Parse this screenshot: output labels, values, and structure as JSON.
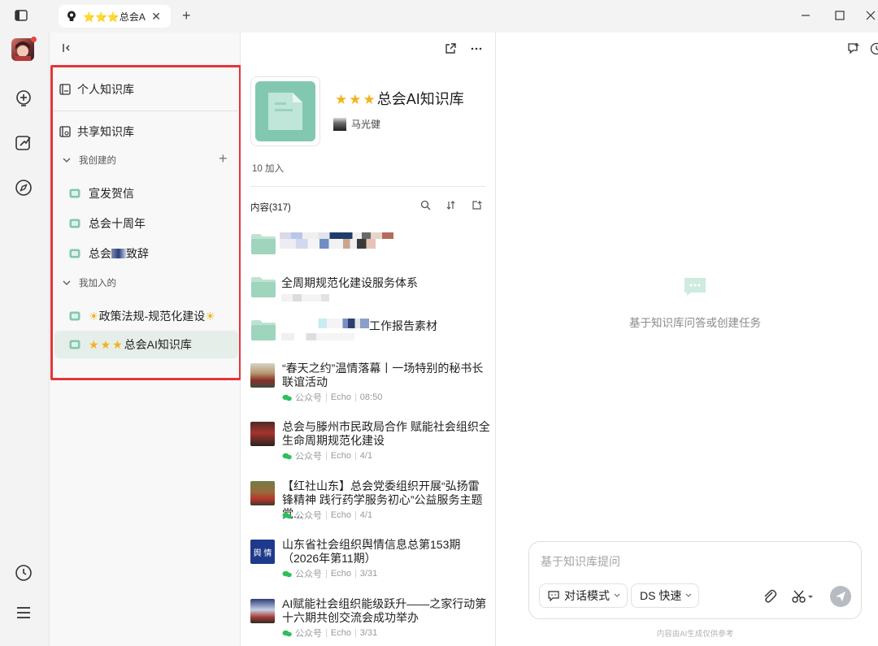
{
  "window": {
    "tab": {
      "title": "⭐⭐⭐总会AI知识库"
    }
  },
  "sidebar": {
    "personal_kb": "个人知识库",
    "shared_kb": "共享知识库",
    "created_section": "我创建的",
    "created_items": [
      {
        "label": "宣发贺信"
      },
      {
        "label": "总会十周年"
      },
      {
        "label_prefix": "总会",
        "label_suffix": "致辞"
      }
    ],
    "joined_section": "我加入的",
    "joined_items": [
      {
        "label": "政策法规-规范化建设"
      },
      {
        "label": "总会AI知识库"
      }
    ]
  },
  "detail": {
    "title": "总会AI知识库",
    "owner": "马光健",
    "join_count": "10 加入",
    "content_header": "内容(317)",
    "folders": [
      {
        "title": ""
      },
      {
        "title": "全周期规范化建设服务体系"
      },
      {
        "title": "工作报告素材"
      }
    ],
    "articles": [
      {
        "title": "“春天之约”温情落幕丨一场特别的秘书长联谊活动",
        "source": "公众号",
        "author": "Echo",
        "date": "08:50"
      },
      {
        "title": "总会与滕州市民政局合作  赋能社会组织全生命周期规范化建设",
        "source": "公众号",
        "author": "Echo",
        "date": "4/1"
      },
      {
        "title": "【红社山东】总会党委组织开展“弘扬雷锋精神 践行药学服务初心”公益服务主题党...",
        "source": "公众号",
        "author": "Echo",
        "date": "4/1"
      },
      {
        "title": "山东省社会组织舆情信息总第153期（2026年第11期）",
        "source": "公众号",
        "author": "Echo",
        "date": "3/31",
        "thumb_text": "舆 情"
      },
      {
        "title": "AI赋能社会组织能级跃升——之家行动第十六期共创交流会成功举办",
        "source": "公众号",
        "author": "Echo",
        "date": "3/31"
      }
    ]
  },
  "chat": {
    "empty_text": "基于知识库问答或创建任务",
    "input_placeholder": "基于知识库提问",
    "mode_label": "对话模式",
    "model_label": "DS 快速",
    "disclaimer": "内容由AI生成仅供参考"
  },
  "colors": {
    "accent_green": "#82c8b0",
    "highlight_red": "#e3353b",
    "active_item_bg": "#e6eee9",
    "star": "#f2b21a"
  }
}
